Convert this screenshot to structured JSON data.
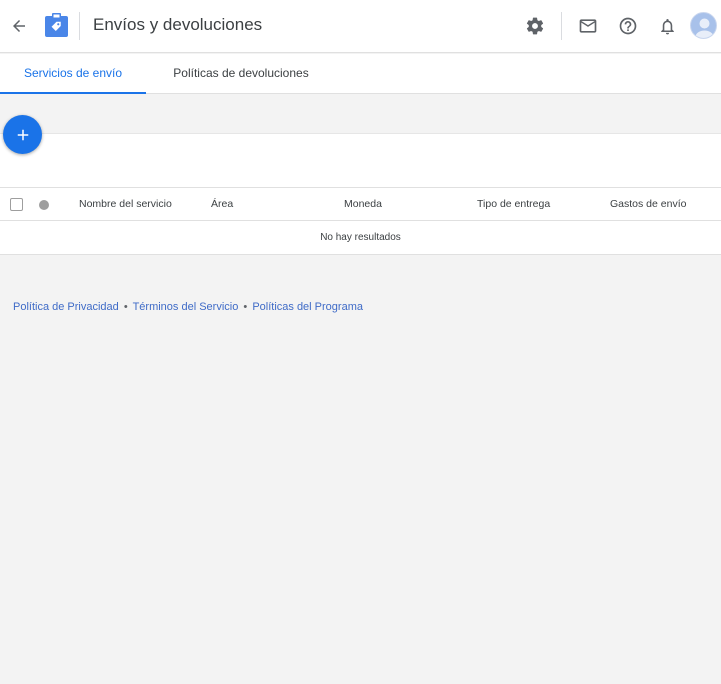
{
  "header": {
    "title": "Envíos y devoluciones",
    "back_icon": "arrow-back-icon",
    "logo_icon": "shopping-bag-tag-icon",
    "accent_color": "#1a73e8"
  },
  "header_actions": {
    "settings_icon": "gear-icon",
    "mail_icon": "mail-icon",
    "help_icon": "help-circle-icon",
    "notifications_icon": "bell-icon",
    "avatar_icon": "user-avatar-icon"
  },
  "tabs": [
    {
      "label": "Servicios de envío",
      "active": true
    },
    {
      "label": "Políticas de devoluciones",
      "active": false
    }
  ],
  "fab": {
    "icon": "plus-icon"
  },
  "table": {
    "columns": [
      "Nombre del servicio",
      "Área",
      "Moneda",
      "Tipo de entrega",
      "Gastos de envío"
    ],
    "empty_message": "No hay resultados"
  },
  "footer": {
    "links": [
      "Política de Privacidad",
      "Términos del Servicio",
      "Políticas del Programa"
    ],
    "separator": "•"
  }
}
